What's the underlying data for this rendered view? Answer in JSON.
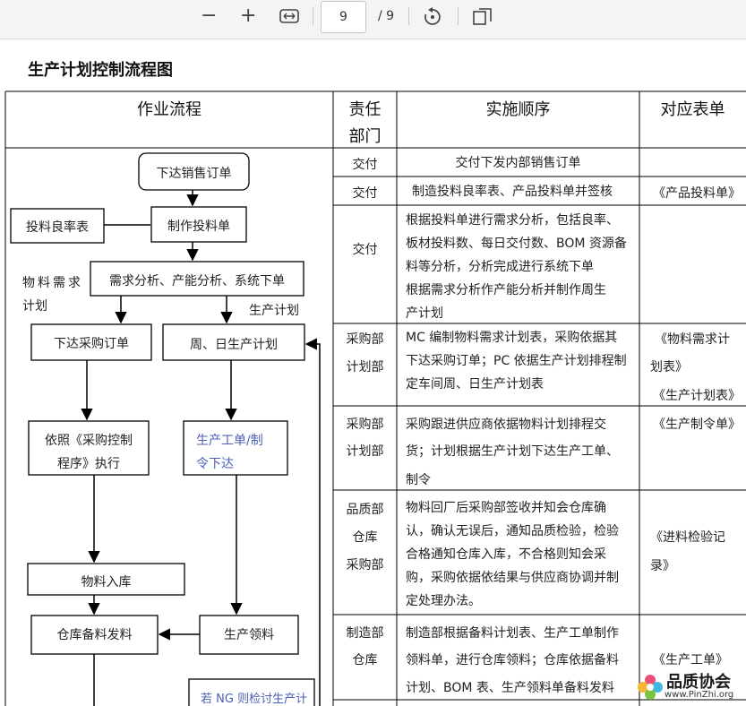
{
  "toolbar": {
    "zoom_out": "−",
    "zoom_in": "+",
    "page_current": "9",
    "page_total": "/ 9"
  },
  "doc": {
    "title": "生产计划控制流程图"
  },
  "table": {
    "headers": {
      "flow": "作业流程",
      "resp_l1": "责任",
      "resp_l2": "部门",
      "order": "实施顺序",
      "forms": "对应表单"
    },
    "rows": [
      {
        "dept": [
          "交付"
        ],
        "steps": [
          "交付下发内部销售订单"
        ],
        "forms": []
      },
      {
        "dept": [
          "交付"
        ],
        "steps": [
          "制造投料良率表、产品投料单并签核"
        ],
        "forms": [
          "《产品投料单》"
        ]
      },
      {
        "dept": [
          "交付"
        ],
        "steps": [
          "根据投料单进行需求分析，包括良率、",
          "板材投料数、每日交付数、BOM 资源备",
          "料等分析，分析完成进行系统下单",
          "根据需求分析作产能分析并制作周生",
          "产计划"
        ],
        "forms": []
      },
      {
        "dept": [
          "采购部",
          "计划部"
        ],
        "steps": [
          "MC 编制物料需求计划表，采购依据其",
          "下达采购订单；PC 依据生产计划排程制",
          "定车间周、日生产计划表"
        ],
        "forms": [
          "《物料需求计",
          "划表》",
          "《生产计划表》"
        ]
      },
      {
        "dept": [
          "采购部",
          "计划部"
        ],
        "steps": [
          "采购跟进供应商依据物料计划排程交",
          "货；计划根据生产计划下达生产工单、",
          "制令"
        ],
        "forms": [
          "《生产制令单》"
        ]
      },
      {
        "dept": [
          "品质部",
          "仓库",
          "采购部"
        ],
        "steps": [
          "物料回厂后采购部签收并知会仓库确",
          "认，确认无误后，通知品质检验，检验",
          "合格通知仓库入库，不合格则知会采",
          "购，采购依据依结果与供应商协调并制",
          "定处理办法。"
        ],
        "forms": [
          "《进料检验记",
          "录》"
        ]
      },
      {
        "dept": [
          "制造部",
          "仓库"
        ],
        "steps": [
          "制造部根据备料计划表、生产工单制作",
          "领料单，进行仓库领料；仓库依据备料",
          "计划、BOM 表、生产领料单备料发料"
        ],
        "forms": [
          "《生产工单》"
        ]
      }
    ]
  },
  "flow": {
    "sales_order": "下达销售订单",
    "yield_table": "投料良率表",
    "feed_sheet": "制作投料单",
    "analysis": "需求分析、产能分析、系统下单",
    "material_plan_l1": "物料需求",
    "material_plan_l2": "计划",
    "prod_plan_label": "生产计划",
    "purchase_order": "下达采购订单",
    "weekly_plan": "周、日生产计划",
    "purchase_ctrl_l1": "依照《采购控制",
    "purchase_ctrl_l2": "程序》执行",
    "work_order_l1": "生产工单/制",
    "work_order_l2": "令下达",
    "warehousing": "物料入库",
    "issue": "仓库备料发料",
    "picking": "生产领料",
    "ng_note": "若 NG 则检讨生产计"
  },
  "watermark": {
    "name": "品质协会",
    "url": "www.PinZhi.org"
  },
  "colors": {
    "blue_text": "#4a5fb5",
    "toolbar_bg": "#f4f4f4"
  }
}
